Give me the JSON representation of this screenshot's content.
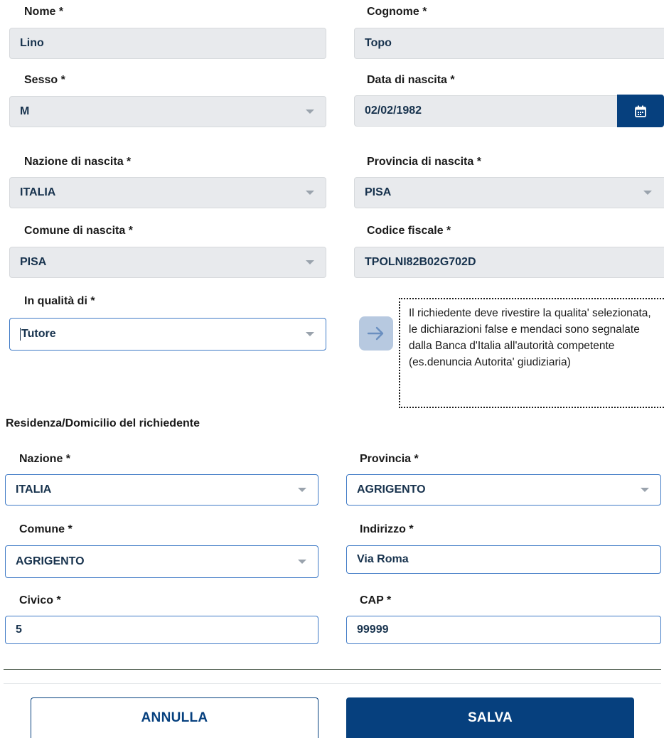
{
  "person": {
    "nome": {
      "label": "Nome *",
      "value": "Lino"
    },
    "cognome": {
      "label": "Cognome *",
      "value": "Topo"
    },
    "sesso": {
      "label": "Sesso *",
      "value": "M"
    },
    "data_nascita": {
      "label": "Data di nascita *",
      "value": "02/02/1982",
      "icon": "calendar-icon"
    },
    "nazione_nascita": {
      "label": "Nazione di nascita *",
      "value": "ITALIA"
    },
    "provincia_nascita": {
      "label": "Provincia di nascita *",
      "value": "PISA"
    },
    "comune_nascita": {
      "label": "Comune di nascita *",
      "value": "PISA"
    },
    "codice_fiscale": {
      "label": "Codice fiscale *",
      "value": "TPOLNI82B02G702D"
    },
    "qualita": {
      "label": "In qualità di *",
      "value": "Tutore"
    }
  },
  "notice": {
    "icon": "arrow-right-icon",
    "text": "Il richiedente deve rivestire la qualita' selezionata, le dichiarazioni false e mendaci sono segnalate dalla Banca d'Italia all'autorità competente (es.denuncia Autorita' giudiziaria)"
  },
  "residenza": {
    "title": "Residenza/Domicilio del richiedente",
    "nazione": {
      "label": "Nazione *",
      "value": "ITALIA"
    },
    "provincia": {
      "label": "Provincia *",
      "value": "AGRIGENTO"
    },
    "comune": {
      "label": "Comune *",
      "value": "AGRIGENTO"
    },
    "indirizzo": {
      "label": "Indirizzo *",
      "value": "Via Roma"
    },
    "civico": {
      "label": "Civico *",
      "value": "5"
    },
    "cap": {
      "label": "CAP *",
      "value": "99999"
    }
  },
  "actions": {
    "cancel": "ANNULLA",
    "save": "SALVA"
  },
  "colors": {
    "primary": "#06407e",
    "field_disabled": "#e8eaed",
    "field_active_border": "#3f7ac6"
  }
}
